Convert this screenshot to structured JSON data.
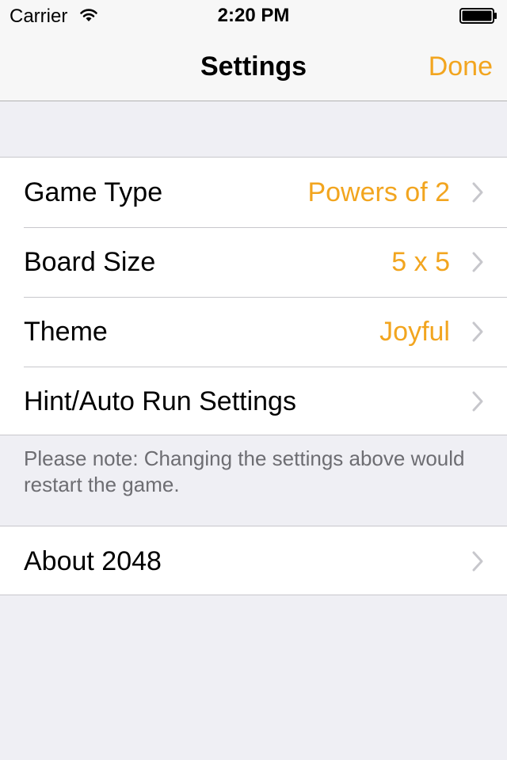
{
  "status_bar": {
    "carrier": "Carrier",
    "time": "2:20 PM"
  },
  "nav": {
    "title": "Settings",
    "done_label": "Done"
  },
  "accent_color": "#f2a51f",
  "settings_rows": [
    {
      "label": "Game Type",
      "value": "Powers of 2"
    },
    {
      "label": "Board Size",
      "value": "5 x 5"
    },
    {
      "label": "Theme",
      "value": "Joyful"
    },
    {
      "label": "Hint/Auto Run Settings",
      "value": ""
    }
  ],
  "note": "Please note: Changing the settings above would restart the game.",
  "about_row": {
    "label": "About 2048"
  },
  "icons": {
    "signal": "wifi-icon",
    "battery": "battery-icon",
    "disclosure": "chevron-right-icon"
  }
}
